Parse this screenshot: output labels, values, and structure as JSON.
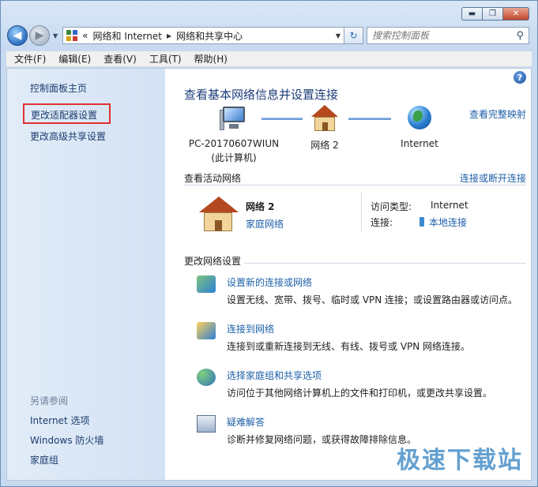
{
  "window": {
    "caption": {
      "minimize": "▬",
      "maximize": "❐",
      "close": "✕"
    }
  },
  "nav": {
    "back": "◀",
    "forward": "▶",
    "address_segments": [
      "«",
      "网络和 Internet",
      "网络和共享中心"
    ],
    "refresh": "↻",
    "search_placeholder": "搜索控制面板"
  },
  "menu": [
    "文件(F)",
    "编辑(E)",
    "查看(V)",
    "工具(T)",
    "帮助(H)"
  ],
  "sidebar": {
    "home": "控制面板主页",
    "adapter": "更改适配器设置",
    "sharing": "更改高级共享设置",
    "see_also": "另请参阅",
    "see_also_links": [
      "Internet 选项",
      "Windows 防火墙",
      "家庭组"
    ]
  },
  "main": {
    "help": "?",
    "title": "查看基本网络信息并设置连接",
    "view_full_map": "查看完整映射",
    "map": {
      "pc_name": "PC-20170607WIUN",
      "pc_sub": "(此计算机)",
      "network": "网络  2",
      "internet": "Internet"
    },
    "active_heading": "查看活动网络",
    "connect_disconnect": "连接或断开连接",
    "active": {
      "name": "网络  2",
      "type": "家庭网络",
      "access_label": "访问类型:",
      "access_value": "Internet",
      "conn_label": "连接:",
      "conn_value": "本地连接"
    },
    "change_heading": "更改网络设置",
    "tasks": [
      {
        "link": "设置新的连接或网络",
        "desc": "设置无线、宽带、拨号、临时或 VPN 连接；或设置路由器或访问点。"
      },
      {
        "link": "连接到网络",
        "desc": "连接到或重新连接到无线、有线、拨号或 VPN 网络连接。"
      },
      {
        "link": "选择家庭组和共享选项",
        "desc": "访问位于其他网络计算机上的文件和打印机，或更改共享设置。"
      },
      {
        "link": "疑难解答",
        "desc": "诊断并修复网络问题，或获得故障排除信息。"
      }
    ]
  },
  "watermark": "极速下载站"
}
